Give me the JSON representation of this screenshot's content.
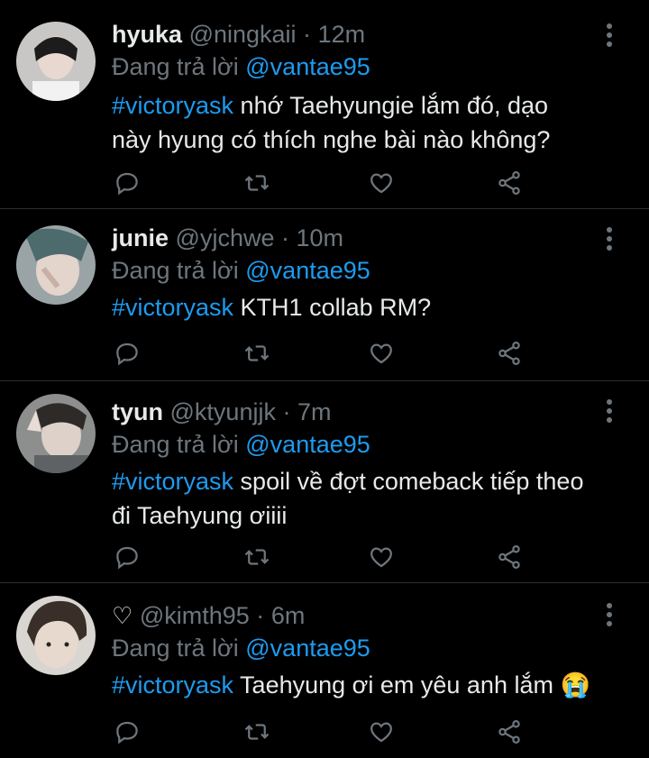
{
  "tweets": [
    {
      "name": "hyuka",
      "handle": "@ningkaii",
      "time": "12m",
      "replying_prefix": "Đang trả lời ",
      "replying_to": "@vantae95",
      "hashtag": "#victoryask",
      "text_line1": " nhớ Taehyungie lắm đó, dạo",
      "text_line2": "này hyung có thích nghe bài nào không?"
    },
    {
      "name": "junie",
      "handle": "@yjchwe",
      "time": "10m",
      "replying_prefix": "Đang trả lời ",
      "replying_to": "@vantae95",
      "hashtag": "#victoryask",
      "text_line1": " KTH1 collab RM?"
    },
    {
      "name": "tyun",
      "handle": "@ktyunjjk",
      "time": "7m",
      "replying_prefix": "Đang trả lời ",
      "replying_to": "@vantae95",
      "hashtag": "#victoryask",
      "text_line1": " spoil về đợt comeback tiếp theo",
      "text_line2": "đi Taehyung ơiiii"
    },
    {
      "name": "♡",
      "handle": "@kimth95",
      "time": "6m",
      "replying_prefix": "Đang trả lời ",
      "replying_to": "@vantae95",
      "hashtag": "#victoryask",
      "text_line1": " Taehyung ơi em yêu anh lắm 😭"
    }
  ],
  "separator": "·",
  "icons": [
    "more-icon",
    "reply-icon",
    "retweet-icon",
    "like-icon",
    "share-icon"
  ],
  "colors": {
    "accent": "#1d9bf0",
    "muted": "#6e767d",
    "background": "#000000"
  }
}
